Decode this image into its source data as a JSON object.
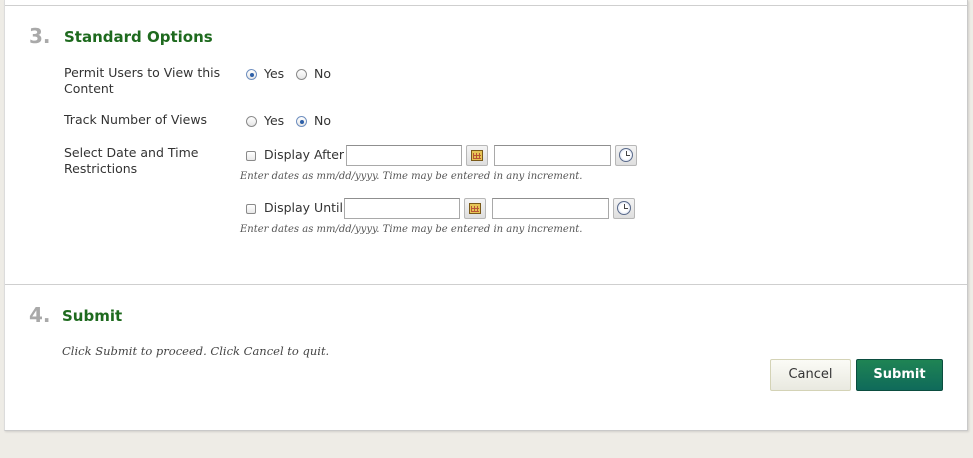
{
  "section3": {
    "number": "3.",
    "title": "Standard Options",
    "permit": {
      "label": "Permit Users to View this Content",
      "yes_label": "Yes",
      "no_label": "No",
      "selected": "Yes"
    },
    "track": {
      "label": "Track Number of Views",
      "yes_label": "Yes",
      "no_label": "No",
      "selected": "No"
    },
    "dates": {
      "label": "Select Date and Time Restrictions",
      "display_after": {
        "label": "Display After",
        "checked": false,
        "date_value": "",
        "time_value": "",
        "hint": "Enter dates as mm/dd/yyyy. Time may be entered in any increment."
      },
      "display_until": {
        "label": "Display Until",
        "checked": false,
        "date_value": "",
        "time_value": "",
        "hint": "Enter dates as mm/dd/yyyy. Time may be entered in any increment."
      }
    }
  },
  "section4": {
    "number": "4.",
    "title": "Submit",
    "instruction": "Click Submit to proceed. Click Cancel to quit.",
    "cancel_label": "Cancel",
    "submit_label": "Submit"
  },
  "icons": {
    "calendar": "calendar-icon",
    "clock": "clock-icon"
  },
  "colors": {
    "section_title": "#1e6a1e",
    "step_number": "#a9a9a9",
    "submit_button": "#157a57",
    "radio_selected": "#2d5fa8"
  }
}
